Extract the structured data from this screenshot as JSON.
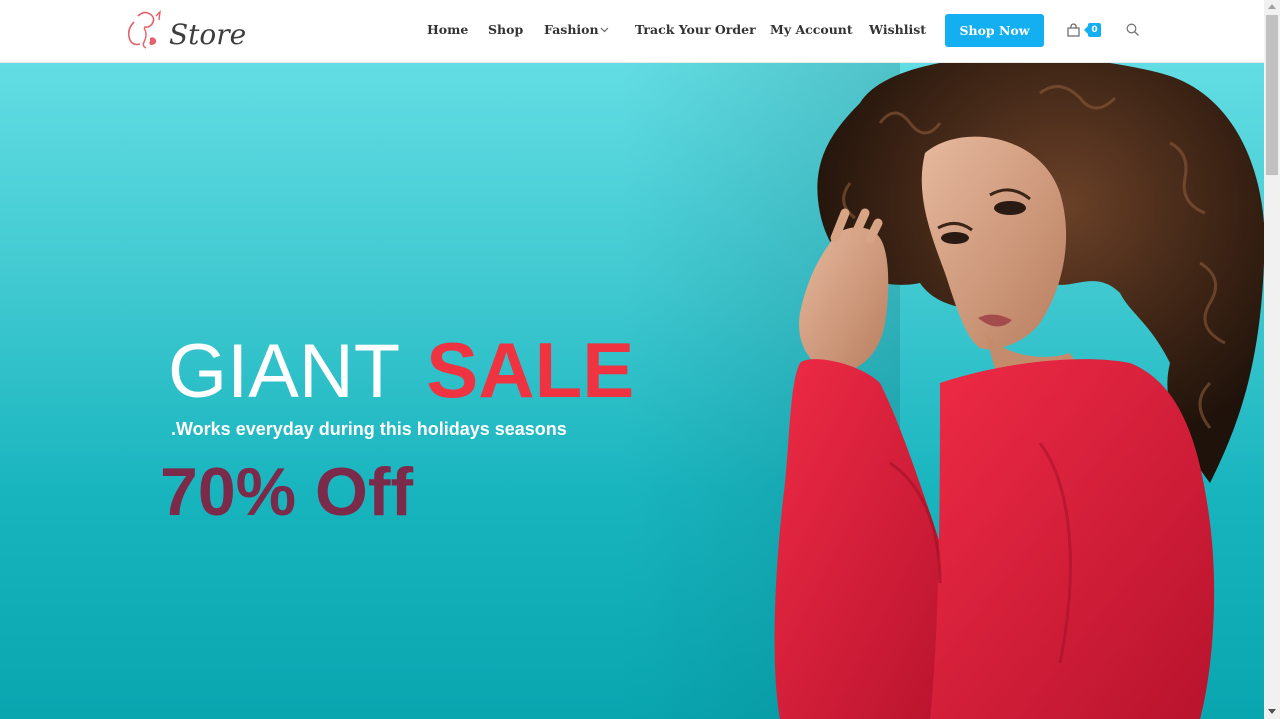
{
  "header": {
    "logo_text": "Store",
    "nav": [
      {
        "label": "Home"
      },
      {
        "label": "Shop"
      },
      {
        "label": "Fashion"
      },
      {
        "label": "Track Your Order"
      },
      {
        "label": "My Account"
      },
      {
        "label": "Wishlist"
      }
    ],
    "shop_now_label": "Shop Now",
    "cart_count": "0",
    "icons": {
      "cart": "shopping-bag-icon",
      "search": "search-icon",
      "dropdown": "chevron-down-icon"
    }
  },
  "hero": {
    "title_word1": "GIANT",
    "title_word2": "SALE",
    "subtitle": ".Works everyday during this holidays seasons",
    "discount": "70% Off"
  },
  "colors": {
    "accent": "#13aff0",
    "sale_red": "#ef3340",
    "discount_maroon": "#7b2a4a",
    "hero_teal": "#19b5bf"
  }
}
